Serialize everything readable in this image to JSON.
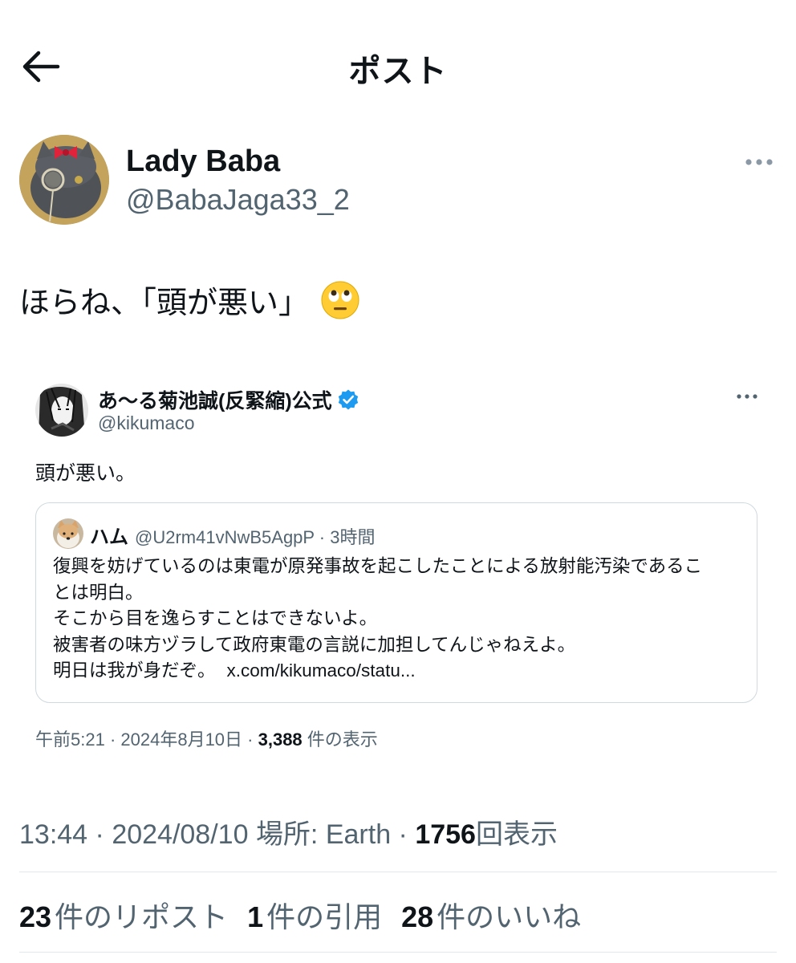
{
  "header": {
    "title": "ポスト",
    "back_icon": "arrow-left-icon"
  },
  "post": {
    "author_name": "Lady Baba",
    "author_handle": "@BabaJaga33_2",
    "text": "ほらね、「頭が悪い」",
    "emoji": "face-with-rolling-eyes",
    "timestamp": "13:44",
    "date": "2024/08/10",
    "location_label": "場所:",
    "location": "Earth",
    "views": "1756",
    "views_label": "回表示"
  },
  "embedded": {
    "author_name": "あ〜る菊池誠(反緊縮)公式",
    "author_handle": "@kikumaco",
    "verified": true,
    "text": "頭が悪い。",
    "quote": {
      "author_name": "ハム",
      "author_handle": "@U2rm41vNwB5AgpP",
      "time": "3時間",
      "lines": [
        "復興を妨げているのは東電が原発事故を起こしたことによる放射能汚染であるこ",
        "とは明白。",
        "そこから目を逸らすことはできないよ。",
        "被害者の味方ヅラして政府東電の言説に加担してんじゃねえよ。",
        "明日は我が身だぞ。"
      ],
      "link": "x.com/kikumaco/statu..."
    },
    "time": "午前5:21",
    "date": "2024年8月10日",
    "views": "3,388",
    "views_label": "件の表示"
  },
  "stats": {
    "reposts": "23",
    "reposts_label": "件のリポスト",
    "quotes": "1",
    "quotes_label": "件の引用",
    "likes": "28",
    "likes_label": "件のいいね"
  },
  "colors": {
    "text": "#0f1419",
    "secondary": "#536471",
    "verified": "#1d9bf0",
    "border": "#cfd9de"
  }
}
